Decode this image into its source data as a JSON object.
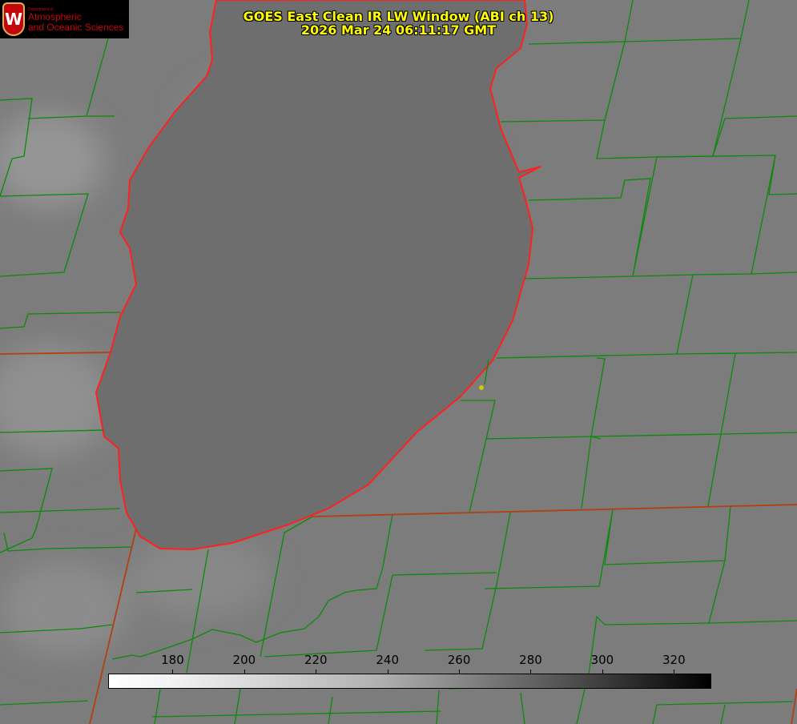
{
  "title": {
    "line1": "GOES East Clean IR LW Window (ABI ch 13)",
    "line2": "2026 Mar 24 06:11:17 GMT"
  },
  "logo": {
    "dept": "Department of",
    "line1": "Atmospheric",
    "line2": "and Oceanic Sciences",
    "emblem": "W"
  },
  "colorbar": {
    "min": 162,
    "max": 330,
    "ticks": [
      "180",
      "200",
      "220",
      "240",
      "260",
      "280",
      "300",
      "320"
    ],
    "tick_values": [
      180,
      200,
      220,
      240,
      260,
      280,
      300,
      320
    ],
    "colormap": "gray inverted (white=cold, black=warm)"
  },
  "colors": {
    "coastline": "#ff2020",
    "county_lines": "#0a8a0a",
    "state_lines": "#b04010",
    "marker": "#d4c800",
    "title": "#ffff00"
  }
}
